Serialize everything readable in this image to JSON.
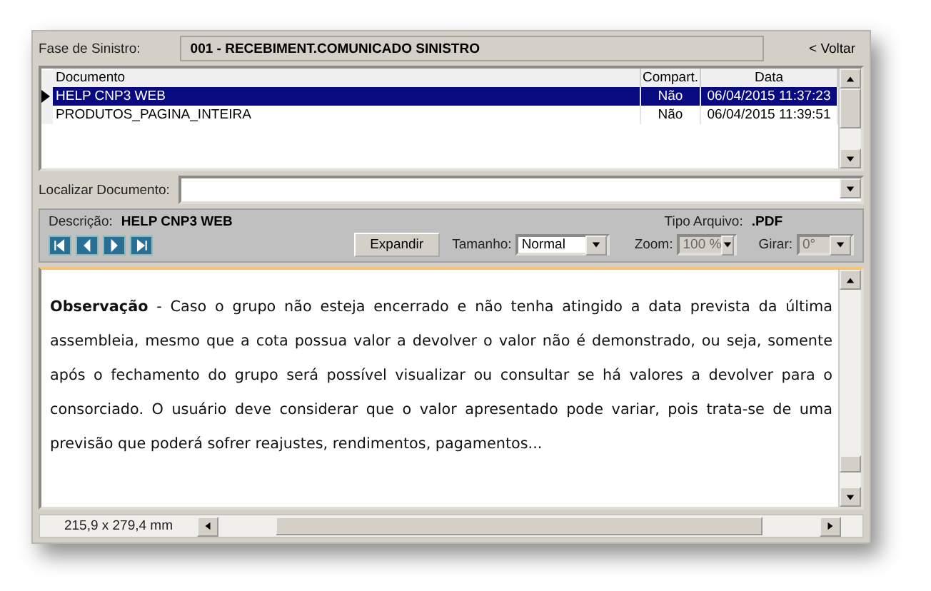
{
  "phase": {
    "label": "Fase de Sinistro:",
    "value": "001 - RECEBIMENT.COMUNICADO SINISTRO"
  },
  "back_link": "< Voltar",
  "table": {
    "columns": [
      "Documento",
      "Compart.",
      "Data"
    ],
    "rows": [
      {
        "cells": [
          "HELP CNP3 WEB",
          "Não",
          "06/04/2015 11:37:23"
        ],
        "selected": true
      },
      {
        "cells": [
          "PRODUTOS_PAGINA_INTEIRA",
          "Não",
          "06/04/2015 11:39:51"
        ],
        "selected": false
      }
    ]
  },
  "search": {
    "label": "Localizar Documento:"
  },
  "details": {
    "description_label": "Descrição:",
    "description": "HELP CNP3 WEB",
    "type_label": "Tipo Arquivo:",
    "type": ".PDF"
  },
  "toolbar": {
    "expand": "Expandir",
    "size_label": "Tamanho:",
    "size": "Normal",
    "zoom_label": "Zoom:",
    "zoom": "100 %",
    "zoom_disabled": true,
    "rotate_label": "Girar:",
    "rotate": "0°",
    "rotate_disabled": true
  },
  "document": {
    "text": "**Observação** - Caso o grupo não esteja encerrado e não tenha atingido a data prevista da última assembleia, mesmo que a cota possua valor a devolver o valor não é demonstrado, ou seja, somente após o fechamento do grupo será possível visualizar ou consultar se há valores a devolver para o consorciado. O usuário deve considerar que o valor apresentado pode variar, pois trata-se de uma previsão que poderá sofrer reajustes, rendimentos, pagamentos..."
  },
  "status_bar": {
    "page_size": "215,9 x 279,4 mm"
  }
}
